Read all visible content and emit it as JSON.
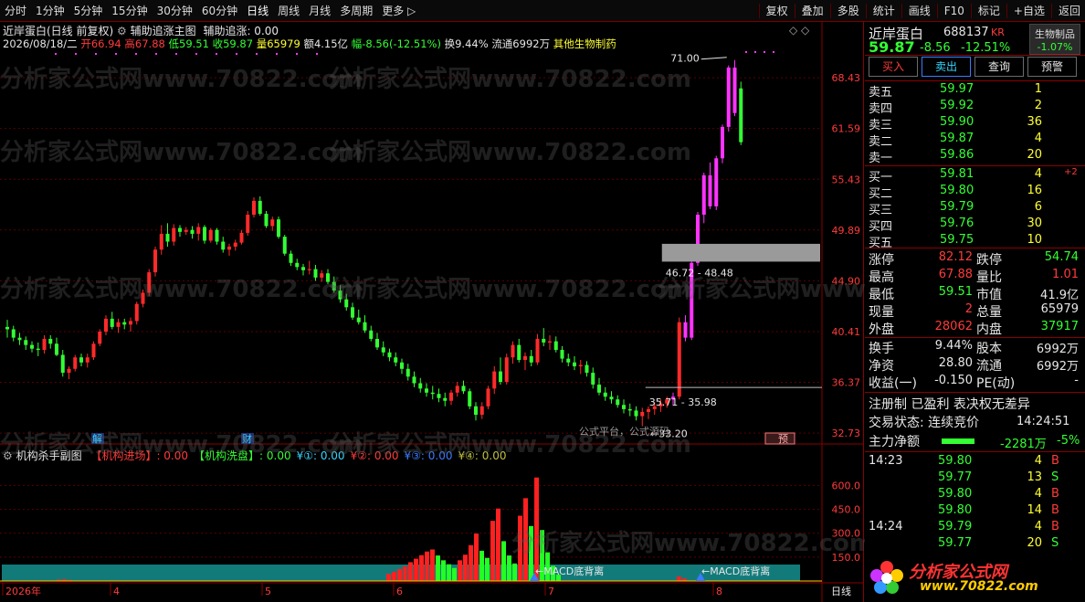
{
  "toolbar": {
    "items": [
      "分时",
      "1分钟",
      "5分钟",
      "15分钟",
      "30分钟",
      "60分钟",
      "日线",
      "周线",
      "月线",
      "多周期",
      "更多 ▷"
    ],
    "right_items": [
      "复权",
      "叠加",
      "多股",
      "统计",
      "画线",
      "F10",
      "标记",
      "+自选",
      "返回"
    ]
  },
  "main_chart": {
    "title": "近岸蛋白(日线 前复权)",
    "indicator_name": "辅助追涨主图",
    "indicator_value": "辅助追涨: 0.00",
    "info_date": "2026/08/18/二",
    "info_open": "开66.94",
    "info_high": "高67.88",
    "info_low": "低59.51",
    "info_close": "收59.87",
    "info_vol": "量65979",
    "info_amt": "额4.15亿",
    "info_chg": "幅-8.56(-12.51%)",
    "info_turn": "换9.44%",
    "info_float": "流通6992万",
    "info_industry": "其他生物制药",
    "price_ticks": [
      "68.43",
      "61.59",
      "55.43",
      "49.89",
      "44.90",
      "40.41",
      "36.37",
      "32.73"
    ],
    "label_top": "71.00",
    "label_box1": "46.72 - 48.48",
    "label_box2": "35.71 - 35.98",
    "label_low": "33.20",
    "label_jie": "解",
    "label_cai": "财",
    "label_yue": "预",
    "label_watermark_site": "公式平台，公式源码",
    "colors": {
      "up": "#ff2a2a",
      "down": "#33ff33",
      "magenta": "#ff33ff",
      "grid": "#5a0000"
    }
  },
  "chart_data": {
    "type": "candlestick",
    "title": "",
    "ylim": [
      32.0,
      71.5
    ],
    "scale": "log",
    "candles": [
      [
        40.8,
        41.4,
        39.9,
        40.6
      ],
      [
        40.6,
        40.9,
        39.6,
        39.9
      ],
      [
        39.9,
        40.3,
        39.3,
        39.7
      ],
      [
        39.7,
        40.0,
        38.9,
        39.3
      ],
      [
        39.3,
        39.6,
        38.7,
        39.0
      ],
      [
        39.0,
        39.5,
        38.4,
        38.9
      ],
      [
        38.9,
        40.1,
        38.6,
        39.8
      ],
      [
        39.8,
        40.1,
        39.0,
        39.4
      ],
      [
        39.4,
        39.9,
        38.4,
        38.5
      ],
      [
        38.5,
        38.9,
        36.8,
        37.1
      ],
      [
        37.1,
        37.6,
        36.6,
        37.4
      ],
      [
        37.4,
        38.5,
        37.2,
        38.3
      ],
      [
        38.3,
        38.6,
        37.6,
        37.9
      ],
      [
        37.9,
        38.6,
        37.5,
        38.3
      ],
      [
        38.3,
        39.6,
        38.1,
        39.4
      ],
      [
        39.4,
        40.6,
        39.2,
        40.4
      ],
      [
        40.4,
        41.8,
        40.1,
        41.5
      ],
      [
        41.5,
        42.1,
        40.6,
        40.8
      ],
      [
        40.8,
        41.5,
        40.3,
        41.2
      ],
      [
        41.2,
        41.5,
        40.6,
        41.0
      ],
      [
        41.0,
        41.6,
        40.4,
        41.3
      ],
      [
        41.3,
        43.0,
        41.0,
        42.8
      ],
      [
        42.8,
        44.1,
        42.5,
        43.8
      ],
      [
        43.8,
        46.0,
        43.5,
        45.7
      ],
      [
        45.7,
        48.2,
        45.3,
        47.9
      ],
      [
        47.9,
        50.4,
        47.4,
        49.5
      ],
      [
        49.5,
        50.6,
        48.2,
        48.7
      ],
      [
        48.7,
        50.5,
        48.3,
        50.1
      ],
      [
        50.1,
        50.4,
        49.2,
        49.7
      ],
      [
        49.7,
        50.2,
        49.4,
        49.9
      ],
      [
        49.9,
        50.3,
        49.0,
        49.5
      ],
      [
        49.5,
        50.6,
        48.8,
        50.2
      ],
      [
        50.2,
        50.4,
        48.5,
        48.8
      ],
      [
        48.8,
        50.1,
        48.6,
        49.9
      ],
      [
        49.9,
        50.1,
        48.4,
        48.7
      ],
      [
        48.7,
        49.2,
        47.6,
        47.9
      ],
      [
        47.9,
        48.5,
        47.3,
        48.2
      ],
      [
        48.2,
        48.9,
        47.8,
        48.6
      ],
      [
        48.6,
        49.9,
        48.4,
        49.6
      ],
      [
        49.6,
        51.9,
        49.3,
        51.5
      ],
      [
        51.5,
        53.4,
        51.2,
        53.0
      ],
      [
        53.0,
        53.5,
        51.4,
        51.6
      ],
      [
        51.6,
        51.9,
        50.1,
        50.3
      ],
      [
        50.3,
        51.3,
        49.8,
        51.0
      ],
      [
        51.0,
        51.3,
        49.0,
        49.2
      ],
      [
        49.2,
        49.4,
        47.3,
        47.5
      ],
      [
        47.5,
        47.8,
        46.3,
        46.6
      ],
      [
        46.6,
        47.0,
        45.9,
        46.2
      ],
      [
        46.2,
        46.5,
        45.4,
        45.9
      ],
      [
        45.9,
        46.8,
        45.5,
        46.0
      ],
      [
        46.0,
        46.4,
        44.9,
        45.2
      ],
      [
        45.2,
        45.9,
        44.8,
        45.6
      ],
      [
        45.6,
        46.0,
        44.6,
        44.8
      ],
      [
        44.8,
        45.3,
        43.8,
        44.0
      ],
      [
        44.0,
        44.5,
        42.9,
        43.2
      ],
      [
        43.2,
        43.7,
        42.2,
        42.5
      ],
      [
        42.5,
        42.9,
        41.4,
        41.6
      ],
      [
        41.6,
        42.3,
        41.0,
        41.2
      ],
      [
        41.2,
        41.8,
        40.3,
        40.5
      ],
      [
        40.5,
        40.9,
        39.6,
        39.8
      ],
      [
        39.8,
        40.3,
        38.9,
        39.1
      ],
      [
        39.1,
        39.6,
        38.4,
        38.7
      ],
      [
        38.7,
        39.0,
        38.0,
        38.3
      ],
      [
        38.3,
        38.7,
        37.6,
        37.9
      ],
      [
        37.9,
        38.2,
        37.0,
        37.4
      ],
      [
        37.4,
        37.8,
        36.5,
        36.8
      ],
      [
        36.8,
        37.2,
        36.0,
        36.3
      ],
      [
        36.3,
        36.7,
        35.6,
        35.9
      ],
      [
        35.9,
        36.3,
        35.3,
        35.6
      ],
      [
        35.6,
        36.1,
        35.1,
        35.5
      ],
      [
        35.5,
        35.9,
        34.9,
        35.2
      ],
      [
        35.2,
        35.6,
        34.6,
        35.0
      ],
      [
        35.0,
        35.8,
        34.7,
        35.6
      ],
      [
        35.6,
        36.4,
        35.3,
        36.1
      ],
      [
        36.1,
        36.5,
        35.5,
        35.7
      ],
      [
        35.7,
        35.9,
        34.4,
        34.6
      ],
      [
        34.6,
        34.9,
        33.6,
        34.0
      ],
      [
        34.0,
        34.9,
        33.7,
        34.6
      ],
      [
        34.6,
        36.1,
        34.4,
        35.9
      ],
      [
        35.9,
        37.6,
        35.5,
        37.2
      ],
      [
        37.2,
        38.3,
        36.2,
        36.4
      ],
      [
        36.4,
        38.6,
        36.2,
        38.3
      ],
      [
        38.3,
        39.6,
        37.8,
        39.3
      ],
      [
        39.3,
        39.8,
        37.9,
        38.1
      ],
      [
        38.1,
        38.7,
        37.3,
        38.4
      ],
      [
        38.4,
        38.9,
        37.6,
        37.9
      ],
      [
        37.9,
        40.2,
        37.7,
        39.8
      ],
      [
        39.8,
        40.7,
        39.2,
        39.5
      ],
      [
        39.5,
        40.1,
        38.9,
        39.6
      ],
      [
        39.6,
        40.0,
        38.7,
        38.9
      ],
      [
        38.9,
        39.2,
        37.9,
        38.2
      ],
      [
        38.2,
        38.6,
        37.6,
        37.9
      ],
      [
        37.9,
        38.4,
        37.3,
        37.6
      ],
      [
        37.6,
        38.1,
        37.0,
        37.7
      ],
      [
        37.7,
        38.0,
        36.8,
        37.1
      ],
      [
        37.1,
        37.5,
        35.9,
        36.2
      ],
      [
        36.2,
        36.7,
        35.4,
        35.6
      ],
      [
        35.6,
        36.0,
        35.0,
        35.3
      ],
      [
        35.3,
        35.7,
        34.8,
        35.1
      ],
      [
        35.1,
        35.4,
        34.5,
        34.7
      ],
      [
        34.7,
        35.1,
        34.1,
        34.4
      ],
      [
        34.4,
        34.8,
        33.9,
        34.3
      ],
      [
        34.3,
        34.6,
        33.6,
        33.9
      ],
      [
        33.9,
        34.5,
        33.2,
        34.2
      ],
      [
        34.2,
        34.6,
        33.7,
        34.4
      ],
      [
        34.4,
        34.9,
        34.0,
        34.6
      ],
      [
        34.6,
        35.1,
        34.2,
        34.8
      ],
      [
        34.8,
        35.3,
        34.5,
        35.1
      ],
      [
        35.1,
        35.6,
        34.7,
        35.3
      ],
      [
        35.3,
        41.6,
        35.1,
        41.2
      ],
      [
        41.2,
        41.8,
        39.6,
        39.9
      ],
      [
        39.9,
        46.8,
        39.7,
        46.6
      ],
      [
        46.6,
        51.8,
        46.3,
        51.5
      ],
      [
        51.5,
        56.2,
        50.6,
        55.9
      ],
      [
        55.9,
        57.4,
        52.1,
        52.4
      ],
      [
        52.4,
        58.2,
        52.0,
        57.9
      ],
      [
        57.9,
        62.1,
        57.3,
        61.8
      ],
      [
        61.8,
        70.2,
        61.2,
        69.9
      ],
      [
        69.9,
        71.0,
        63.2,
        63.6
      ],
      [
        66.94,
        67.88,
        59.51,
        59.87
      ]
    ],
    "markers": {
      "top": 71.0,
      "low": 33.2,
      "range_high": [
        46.72,
        48.48
      ],
      "range_low": [
        35.71,
        35.98
      ]
    }
  },
  "sub_chart": {
    "title": "机构杀手副图",
    "legend": [
      {
        "label": "【机构进场】: 0.00",
        "color": "#ff3b3b"
      },
      {
        "label": "【机构洗盘】: 0.00",
        "color": "#33ff33"
      },
      {
        "label": "¥①: 0.00",
        "color": "#35d6ff"
      },
      {
        "label": "¥②: 0.00",
        "color": "#ff3b3b"
      },
      {
        "label": "¥③: 0.00",
        "color": "#3b7bff"
      },
      {
        "label": "¥④: 0.00",
        "color": "#c0c040"
      }
    ],
    "ticks": [
      "600.0",
      "450.0",
      "300.0",
      "150.0"
    ],
    "macd_label1": "←MACD底背离",
    "macd_label2": "←MACD底背离",
    "bottom_label": "日线",
    "date_ticks": [
      "2026年",
      "4",
      "5",
      "6",
      "7",
      "8"
    ],
    "bars": [
      {
        "x": 62,
        "v": 8,
        "c": "r"
      },
      {
        "x": 68,
        "v": 10,
        "c": "r"
      },
      {
        "x": 74,
        "v": 6,
        "c": "r"
      },
      {
        "x": 423,
        "v": 45,
        "c": "r"
      },
      {
        "x": 429,
        "v": 58,
        "c": "r"
      },
      {
        "x": 435,
        "v": 75,
        "c": "r"
      },
      {
        "x": 441,
        "v": 92,
        "c": "r"
      },
      {
        "x": 447,
        "v": 118,
        "c": "r"
      },
      {
        "x": 453,
        "v": 140,
        "c": "r"
      },
      {
        "x": 459,
        "v": 162,
        "c": "r"
      },
      {
        "x": 465,
        "v": 185,
        "c": "r"
      },
      {
        "x": 471,
        "v": 198,
        "c": "r"
      },
      {
        "x": 477,
        "v": 160,
        "c": "g"
      },
      {
        "x": 483,
        "v": 130,
        "c": "g"
      },
      {
        "x": 489,
        "v": 105,
        "c": "g"
      },
      {
        "x": 495,
        "v": 82,
        "c": "g"
      },
      {
        "x": 501,
        "v": 130,
        "c": "r"
      },
      {
        "x": 507,
        "v": 165,
        "c": "r"
      },
      {
        "x": 513,
        "v": 225,
        "c": "r"
      },
      {
        "x": 519,
        "v": 298,
        "c": "r"
      },
      {
        "x": 525,
        "v": 190,
        "c": "g"
      },
      {
        "x": 531,
        "v": 145,
        "c": "g"
      },
      {
        "x": 537,
        "v": 378,
        "c": "r"
      },
      {
        "x": 543,
        "v": 455,
        "c": "r"
      },
      {
        "x": 549,
        "v": 250,
        "c": "g"
      },
      {
        "x": 555,
        "v": 160,
        "c": "g"
      },
      {
        "x": 561,
        "v": 110,
        "c": "g"
      },
      {
        "x": 567,
        "v": 410,
        "c": "r"
      },
      {
        "x": 573,
        "v": 520,
        "c": "r"
      },
      {
        "x": 579,
        "v": 345,
        "c": "g"
      },
      {
        "x": 585,
        "v": 650,
        "c": "r"
      },
      {
        "x": 591,
        "v": 320,
        "c": "g"
      },
      {
        "x": 597,
        "v": 180,
        "c": "g"
      },
      {
        "x": 603,
        "v": 95,
        "c": "g"
      },
      {
        "x": 609,
        "v": 40,
        "c": "g"
      },
      {
        "x": 741,
        "v": 28,
        "c": "r"
      },
      {
        "x": 747,
        "v": 15,
        "c": "r"
      }
    ]
  },
  "quote": {
    "name": "近岸蛋白",
    "code": "688137",
    "tag": "KR",
    "sector": "生物制品",
    "sector_chg": "-1.07%",
    "price": "59.87",
    "chg": "-8.56",
    "pct": "-12.51%",
    "buttons": [
      "买入",
      "卖出",
      "查询",
      "预警"
    ],
    "asks": [
      {
        "label": "卖五",
        "price": "59.97",
        "vol": "1"
      },
      {
        "label": "卖四",
        "price": "59.92",
        "vol": "2"
      },
      {
        "label": "卖三",
        "price": "59.90",
        "vol": "36"
      },
      {
        "label": "卖二",
        "price": "59.87",
        "vol": "4"
      },
      {
        "label": "卖一",
        "price": "59.86",
        "vol": "20"
      }
    ],
    "bids": [
      {
        "label": "买一",
        "price": "59.81",
        "vol": "4",
        "extra": "+2"
      },
      {
        "label": "买二",
        "price": "59.80",
        "vol": "16",
        "extra": ""
      },
      {
        "label": "买三",
        "price": "59.79",
        "vol": "6",
        "extra": ""
      },
      {
        "label": "买四",
        "price": "59.76",
        "vol": "30",
        "extra": ""
      },
      {
        "label": "买五",
        "price": "59.75",
        "vol": "10",
        "extra": ""
      }
    ],
    "stats": [
      {
        "l1": "涨停",
        "v1": "82.12",
        "c1": "red",
        "l2": "跌停",
        "v2": "54.74",
        "c2": "grn"
      },
      {
        "l1": "最高",
        "v1": "67.88",
        "c1": "red",
        "l2": "量比",
        "v2": "1.01",
        "c2": "red"
      },
      {
        "l1": "最低",
        "v1": "59.51",
        "c1": "grn",
        "l2": "市值",
        "v2": "41.9亿",
        "c2": "wht"
      },
      {
        "l1": "现量",
        "v1": "2",
        "c1": "red",
        "l2": "总量",
        "v2": "65979",
        "c2": "wht"
      },
      {
        "l1": "外盘",
        "v1": "28062",
        "c1": "red",
        "l2": "内盘",
        "v2": "37917",
        "c2": "grn"
      }
    ],
    "stats2": [
      {
        "l1": "换手",
        "v1": "9.44%",
        "l2": "股本",
        "v2": "6992万"
      },
      {
        "l1": "净资",
        "v1": "28.80",
        "l2": "流通",
        "v2": "6992万"
      },
      {
        "l1": "收益(一)",
        "v1": "-0.150",
        "l2": "PE(动)",
        "v2": "-"
      }
    ],
    "reg_line": "注册制 已盈利 表决权无差异",
    "trade_state": "交易状态: 连续竞价",
    "trade_time": "14:24:51",
    "netflow_label": "主力净额",
    "netflow_val": "-2281万",
    "netflow_pct": "-5%",
    "ticks": [
      {
        "t": "14:23",
        "p": "59.80",
        "v": "4",
        "s": "B"
      },
      {
        "t": "",
        "p": "59.77",
        "v": "13",
        "s": "S"
      },
      {
        "t": "",
        "p": "59.80",
        "v": "4",
        "s": "B"
      },
      {
        "t": "",
        "p": "59.80",
        "v": "14",
        "s": "B"
      },
      {
        "t": "14:24",
        "p": "59.79",
        "v": "4",
        "s": "B"
      },
      {
        "t": "",
        "p": "59.77",
        "v": "20",
        "s": "S"
      }
    ],
    "logo_text": "分析家公式网",
    "logo_url": "www.70822.com"
  },
  "watermark": "分析家公式网www.70822.com"
}
